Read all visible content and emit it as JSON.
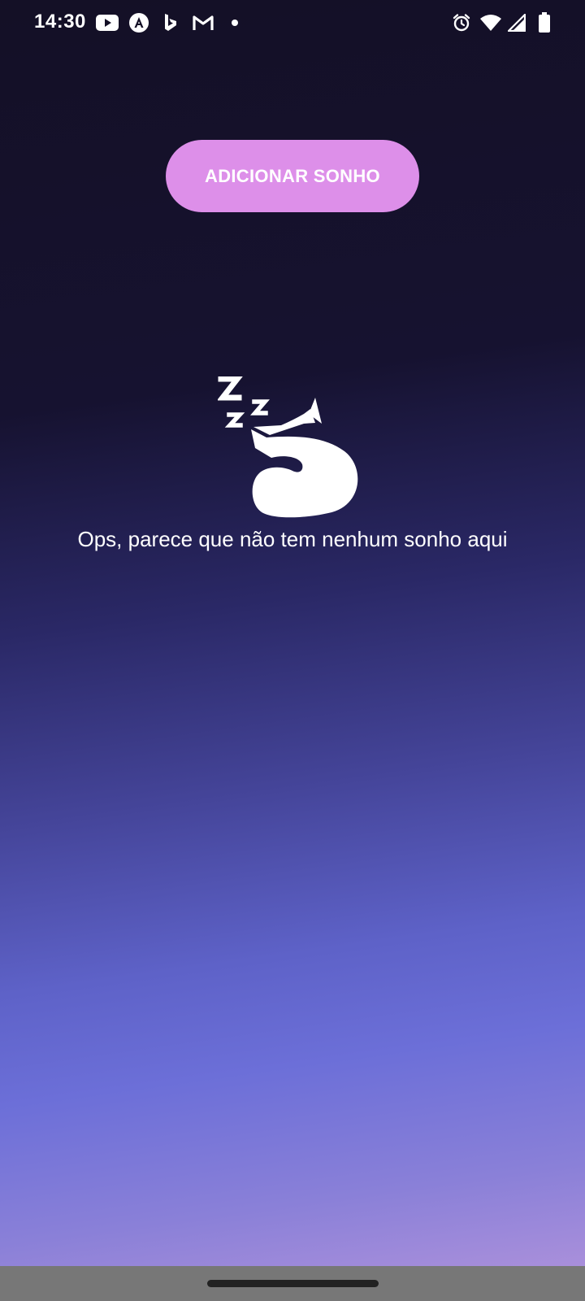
{
  "status_bar": {
    "time": "14:30",
    "left_icons": [
      "youtube-icon",
      "angular-icon",
      "bing-icon",
      "gmail-icon",
      "notification-dot-icon"
    ],
    "right_icons": [
      "alarm-icon",
      "wifi-icon",
      "signal-icon",
      "battery-icon"
    ]
  },
  "main": {
    "add_button_label": "ADICIONAR SONHO",
    "empty_message": "Ops, parece que não tem nenhum sonho aqui",
    "illustration_icon": "sleeping-cat-icon"
  },
  "colors": {
    "button": "#dd8fe9",
    "background_top": "#141026",
    "background_bottom": "#b394dc"
  }
}
